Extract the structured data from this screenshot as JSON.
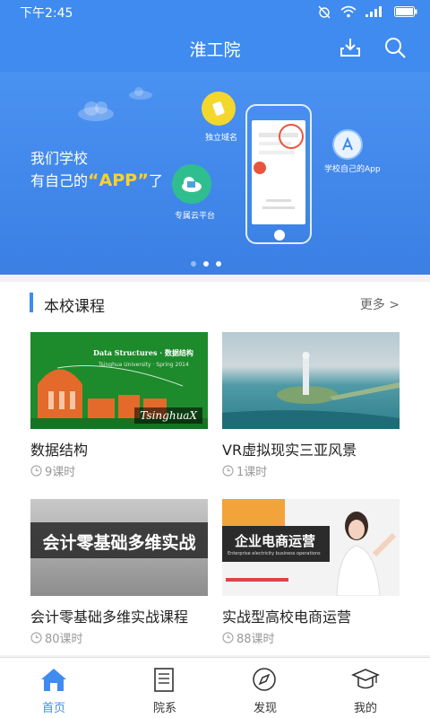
{
  "status_bar": {
    "time": "下午2:45"
  },
  "app_bar": {
    "title": "淮工院"
  },
  "banner": {
    "line1": "我们学校",
    "line2_prefix": "有自己的",
    "line2_app": "“APP”",
    "line2_suffix": "了",
    "label_domain": "独立域名",
    "label_cloud": "专属云平台",
    "label_app": "学校自己的App",
    "slide_count": 3,
    "active_slide": 1
  },
  "courses": {
    "section_title": "本校课程",
    "more_label": "更多 >",
    "items": [
      {
        "title": "数据结构",
        "lessons": "9课时",
        "thumb_text": "Data Structures · 数据结构",
        "thumb_sub": "Tsinghua University · Spring 2014",
        "thumb_logo": "TsinghuaX"
      },
      {
        "title": "VR虚拟现实三亚风景",
        "lessons": "1课时"
      },
      {
        "title": "会计零基础多维实战课程",
        "lessons": "80课时",
        "thumb_text": "会计零基础多维实战"
      },
      {
        "title": "实战型高校电商运营",
        "lessons": "88课时",
        "thumb_text": "企业电商运营",
        "thumb_sub": "Enterprise electricity business operations"
      }
    ]
  },
  "tabs": [
    {
      "label": "首页",
      "icon": "home-icon",
      "active": true
    },
    {
      "label": "院系",
      "icon": "document-icon",
      "active": false
    },
    {
      "label": "发现",
      "icon": "compass-icon",
      "active": false
    },
    {
      "label": "我的",
      "icon": "graduation-cap-icon",
      "active": false
    }
  ],
  "colors": {
    "primary": "#3f8bf0",
    "accent_yellow": "#ffd12a"
  }
}
